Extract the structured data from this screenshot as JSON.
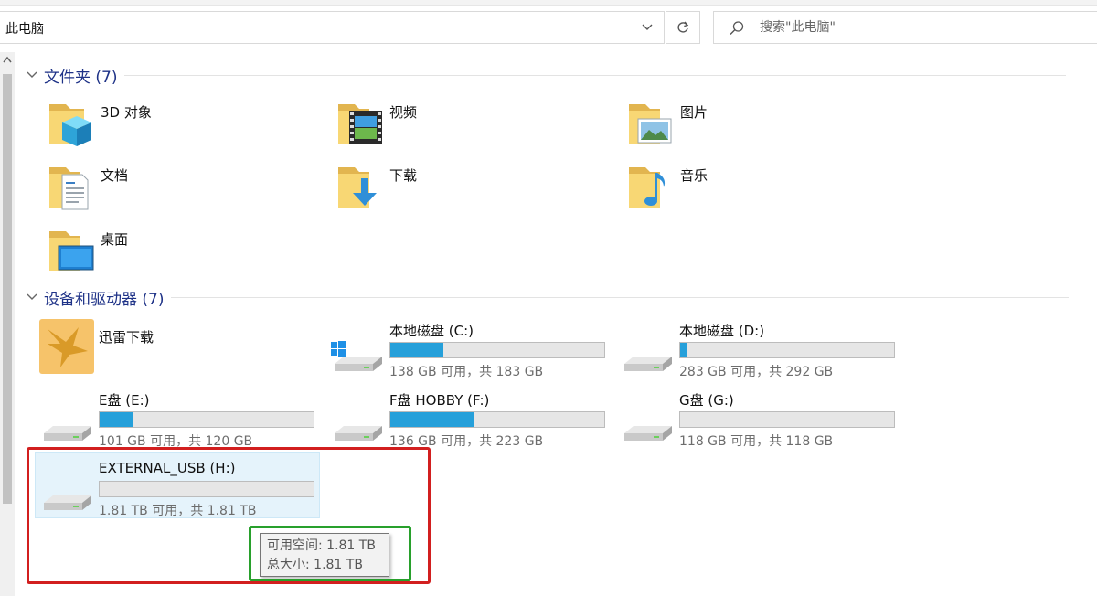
{
  "address": {
    "path": "此电脑"
  },
  "search": {
    "placeholder": "搜索\"此电脑\""
  },
  "groups": {
    "folders": {
      "title": "文件夹 (7)"
    },
    "drives": {
      "title": "设备和驱动器 (7)"
    }
  },
  "folders": [
    {
      "label": "3D 对象",
      "icon": "3d-objects-folder-icon"
    },
    {
      "label": "视频",
      "icon": "videos-folder-icon"
    },
    {
      "label": "图片",
      "icon": "pictures-folder-icon"
    },
    {
      "label": "文档",
      "icon": "documents-folder-icon"
    },
    {
      "label": "下载",
      "icon": "downloads-folder-icon"
    },
    {
      "label": "音乐",
      "icon": "music-folder-icon"
    },
    {
      "label": "桌面",
      "icon": "desktop-folder-icon"
    }
  ],
  "drives": [
    {
      "label": "迅雷下载",
      "icon": "thunder-download-icon"
    },
    {
      "label": "本地磁盘 (C:)",
      "sub": "138 GB 可用，共 183 GB",
      "used_fraction": 0.246,
      "icon": "windows-drive-icon"
    },
    {
      "label": "本地磁盘 (D:)",
      "sub": "283 GB 可用，共 292 GB",
      "used_fraction": 0.031,
      "icon": "hard-drive-icon"
    },
    {
      "label": "E盘 (E:)",
      "sub": "101 GB 可用，共 120 GB",
      "used_fraction": 0.158,
      "icon": "hard-drive-icon"
    },
    {
      "label": "F盘 HOBBY (F:)",
      "sub": "136 GB 可用，共 223 GB",
      "used_fraction": 0.39,
      "icon": "hard-drive-icon"
    },
    {
      "label": "G盘 (G:)",
      "sub": "118 GB 可用，共 118 GB",
      "used_fraction": 0.0,
      "icon": "hard-drive-icon"
    },
    {
      "label": "EXTERNAL_USB (H:)",
      "sub": "1.81 TB 可用，共 1.81 TB",
      "used_fraction": 0.0,
      "icon": "hard-drive-icon"
    }
  ],
  "tooltip": {
    "free": "可用空间: 1.81 TB",
    "total": "总大小: 1.81 TB"
  },
  "colors": {
    "accent": "#26a0da",
    "group_title": "#1e3287",
    "highlight_red": "#d21f1f",
    "highlight_green": "#28a02c",
    "selection": "#e5f3fb"
  }
}
